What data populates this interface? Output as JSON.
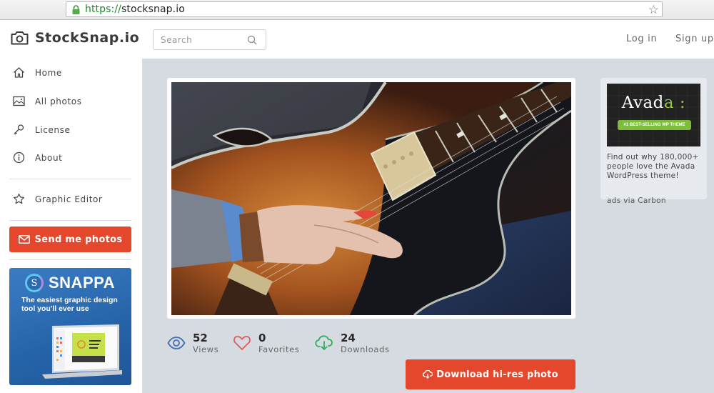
{
  "browser": {
    "url_scheme": "https://",
    "url_host": "stocksnap.io",
    "icons": [
      "lock-icon",
      "bookmark-star-icon"
    ]
  },
  "header": {
    "logo_text": "StockSnap.io",
    "logo_icon": "camera-icon",
    "search_placeholder": "Search",
    "search_value": "",
    "login_label": "Log in",
    "signup_label": "Sign up"
  },
  "sidebar": {
    "items": [
      {
        "label": "Home",
        "icon": "home-icon"
      },
      {
        "label": "All photos",
        "icon": "image-icon"
      },
      {
        "label": "License",
        "icon": "key-icon"
      },
      {
        "label": "About",
        "icon": "info-icon"
      },
      {
        "label": "Graphic Editor",
        "icon": "star-icon"
      }
    ],
    "send_button_label": "Send me photos",
    "ad": {
      "brand": "SNAPPA",
      "logo_letter": "S",
      "tagline": "The easiest graphic design tool you'll ever use"
    }
  },
  "photo": {
    "description": "Close-up of hands playing a sunburst hollow-body electric guitar"
  },
  "stats": [
    {
      "value": "52",
      "label": "Views",
      "icon": "eye-icon",
      "color": "#3f6fb0"
    },
    {
      "value": "0",
      "label": "Favorites",
      "icon": "heart-icon",
      "color": "#e05a5a"
    },
    {
      "value": "24",
      "label": "Downloads",
      "icon": "cloud-download-icon",
      "color": "#2fae5c"
    }
  ],
  "download_button_label": "Download hi-res photo",
  "carbon_ad": {
    "brand_main": "Avad",
    "brand_accent": "a :",
    "pill_text": "#1 BEST-SELLING WP THEME",
    "text": "Find out why 180,000+ people love the Avada WordPress theme!",
    "via": "ads via Carbon"
  },
  "colors": {
    "accent": "#e4472b",
    "main_bg": "#d5dbe1",
    "avada_green": "#7cbd3a"
  }
}
